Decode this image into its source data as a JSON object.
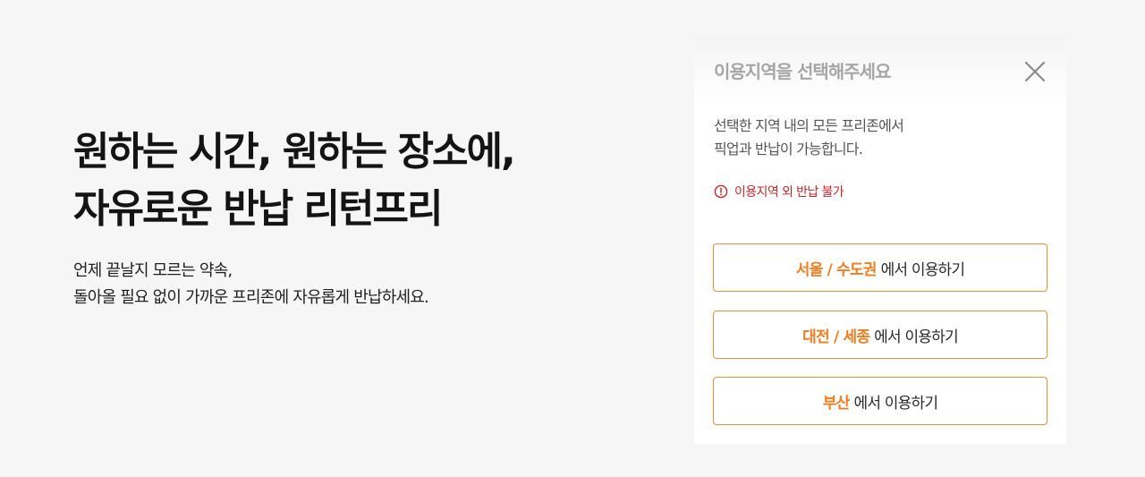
{
  "hero": {
    "title_line1": "원하는 시간, 원하는 장소에,",
    "title_line2": "자유로운 반납 리턴프리",
    "desc_line1": "언제 끝날지 모르는 약속,",
    "desc_line2": "돌아올 필요 없이 가까운 프리존에 자유롭게 반납하세요."
  },
  "modal": {
    "title": "이용지역을 선택해주세요",
    "close_icon": "close-icon",
    "desc_line1": "선택한 지역 내의 모든 프리존에서",
    "desc_line2": "픽업과 반납이 가능합니다.",
    "warning": "이용지역 외 반납 불가",
    "warning_icon": "exclamation-circle-icon",
    "buttons": [
      {
        "region": "서울 / 수도권",
        "suffix": "에서 이용하기"
      },
      {
        "region": "대전 / 세종",
        "suffix": "에서 이용하기"
      },
      {
        "region": "부산",
        "suffix": "에서 이용하기"
      }
    ]
  },
  "colors": {
    "accent": "#ef7d22",
    "border": "#ef8e3a",
    "warning": "#c4282c",
    "background": "#f6f6f6"
  }
}
